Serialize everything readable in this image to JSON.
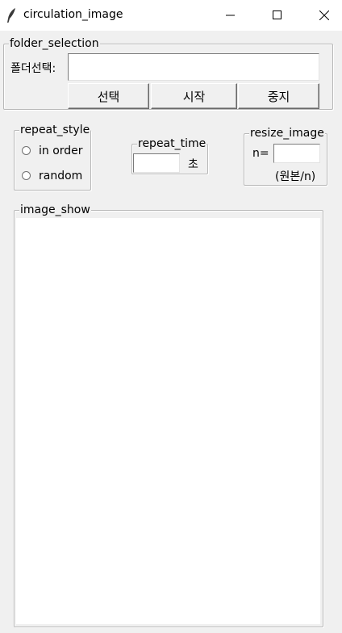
{
  "window": {
    "title": "circulation_image",
    "controls": {
      "minimize": "minimize-icon",
      "maximize": "maximize-icon",
      "close": "close-icon"
    }
  },
  "folder_selection": {
    "legend": "folder_selection",
    "label": "폴더선택:",
    "path_value": "",
    "buttons": {
      "select": "선택",
      "start": "시작",
      "stop": "중지"
    }
  },
  "repeat_style": {
    "legend": "repeat_style",
    "options": [
      {
        "label": "in order",
        "selected": false
      },
      {
        "label": "random",
        "selected": false
      }
    ]
  },
  "repeat_time": {
    "legend": "repeat_time",
    "value": "",
    "unit": "초"
  },
  "resize_image": {
    "legend": "resize_image",
    "label": "n=",
    "value": "",
    "hint": "(원본/n)"
  },
  "image_show": {
    "legend": "image_show"
  }
}
